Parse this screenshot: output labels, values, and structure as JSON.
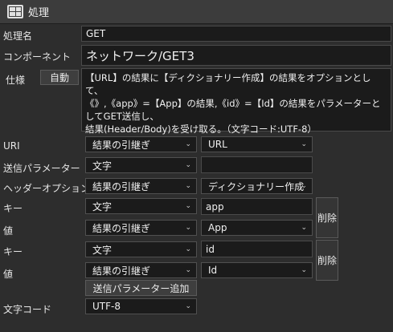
{
  "window": {
    "title": "処理"
  },
  "labels": {
    "process_name": "処理名",
    "component": "コンポーネント",
    "spec": "仕様",
    "uri": "URI",
    "send_params": "送信パラメーター",
    "header_option": "ヘッダーオプション",
    "key": "キー",
    "value": "値",
    "charset": "文字コード"
  },
  "fields": {
    "process_name": "GET",
    "component": "ネットワーク/GET3",
    "spec_auto_button": "自動",
    "spec_text": "【URL】の結果に【ディクショナリー作成】の結果をオプションとして、\n《》,《app》=【App】の結果,《id》=【Id】の結果をパラメーターとしてGET送信し、\n結果(Header/Body)を受け取る。（文字コード:UTF-8）"
  },
  "rows": {
    "uri": {
      "source": "結果の引継ぎ",
      "target": "URL"
    },
    "send_params": {
      "source": "文字",
      "value": ""
    },
    "header_option": {
      "source": "結果の引継ぎ",
      "target": "ディクショナリー作成"
    },
    "pair1_key": {
      "source": "文字",
      "value": "app"
    },
    "pair1_val": {
      "source": "結果の引継ぎ",
      "target": "App"
    },
    "pair2_key": {
      "source": "文字",
      "value": "id"
    },
    "pair2_val": {
      "source": "結果の引継ぎ",
      "target": "Id"
    },
    "delete_label": "削除",
    "add_param_button": "送信パラメーター追加",
    "charset": "UTF-8"
  },
  "icons": {
    "title": "table-icon",
    "dropdown": "chevron-down-icon"
  }
}
